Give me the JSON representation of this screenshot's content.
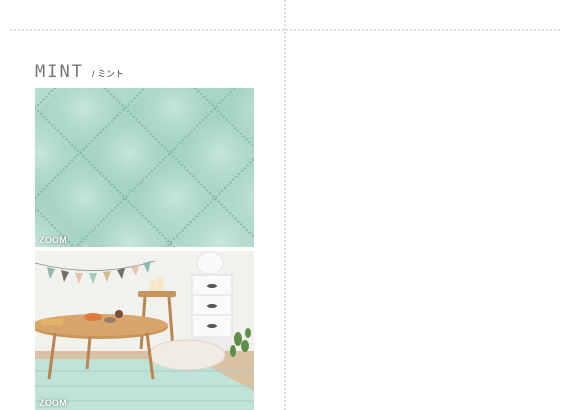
{
  "product": {
    "color_name": "MINT",
    "color_name_jp": "/ ミント"
  },
  "images": [
    {
      "name": "mint-fabric-closeup",
      "zoom_label": "ZOOM",
      "accent": "#a8d6c9"
    },
    {
      "name": "mint-rug-room-scene",
      "zoom_label": "ZOOM",
      "accent": "#bfe3d8"
    }
  ]
}
